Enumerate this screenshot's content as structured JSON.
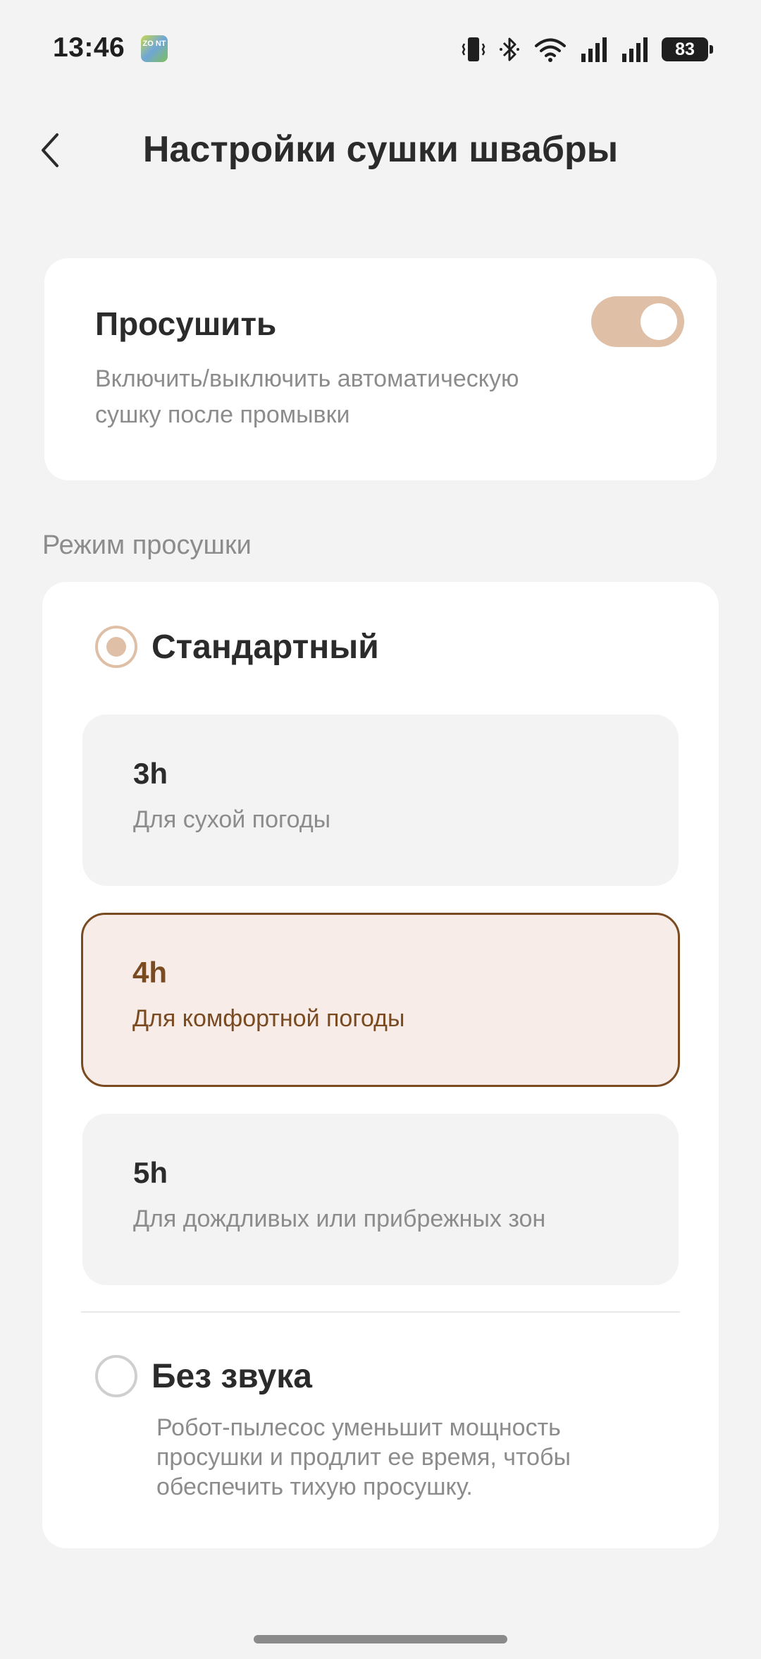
{
  "status_bar": {
    "time": "13:46",
    "app_notification": "ZO NT",
    "icons": [
      "vibrate-icon",
      "bluetooth-icon",
      "wifi-icon",
      "signal-icon",
      "signal-icon"
    ],
    "battery": "83"
  },
  "header": {
    "back_icon": "chevron-left-icon",
    "title": "Настройки сушки швабры"
  },
  "dry_card": {
    "title": "Просушить",
    "description": "Включить/выключить автоматическую сушку после промывки",
    "toggle_on": true
  },
  "mode_section": {
    "label": "Режим просушки",
    "standard": {
      "label": "Стандартный",
      "selected": true,
      "options": [
        {
          "title": "3h",
          "subtitle": "Для сухой погоды",
          "selected": false
        },
        {
          "title": "4h",
          "subtitle": "Для комфортной погоды",
          "selected": true
        },
        {
          "title": "5h",
          "subtitle": "Для дождливых или прибрежных зон",
          "selected": false
        }
      ]
    },
    "silent": {
      "label": "Без звука",
      "selected": false,
      "description": "Робот-пылесос уменьшит мощность просушки и продлит ее время, чтобы обеспечить тихую просушку."
    }
  },
  "colors": {
    "accent": "#dfbfa6",
    "selected_text": "#7a4a21",
    "selected_bg": "#f7ece7",
    "background": "#f3f3f3"
  }
}
